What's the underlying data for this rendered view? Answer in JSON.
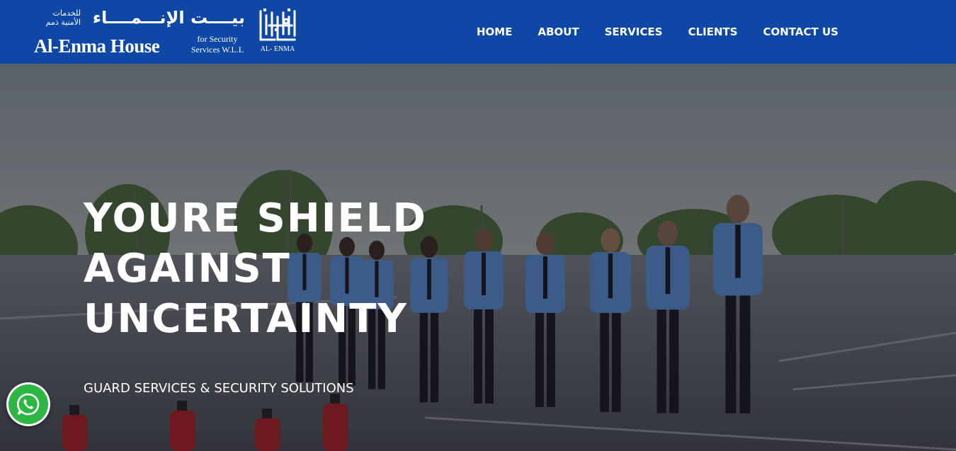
{
  "brand": {
    "arabic_small": "للخدمات الأمنية ذمم",
    "arabic_large": "بيــــت الإنـــمــــاء",
    "name": "Al-Enma House",
    "sub_line1": "for Security",
    "sub_line2": "Services W.L.L",
    "emblem_label": "AL- ENMA"
  },
  "nav": {
    "items": [
      {
        "label": "HOME"
      },
      {
        "label": "ABOUT"
      },
      {
        "label": "SERVICES"
      },
      {
        "label": "CLIENTS"
      },
      {
        "label": "CONTACT US"
      }
    ]
  },
  "hero": {
    "headline": [
      "YOURE SHIELD",
      "AGAINST",
      "UNCERTAINTY"
    ],
    "tagline": "GUARD SERVICES & SECURITY SOLUTIONS"
  },
  "widgets": {
    "whatsapp_icon": "whatsapp-icon"
  },
  "colors": {
    "header_bg": "#0e47a6",
    "whatsapp_green": "#2bb741",
    "uniform_blue": "#5b8fd6"
  }
}
